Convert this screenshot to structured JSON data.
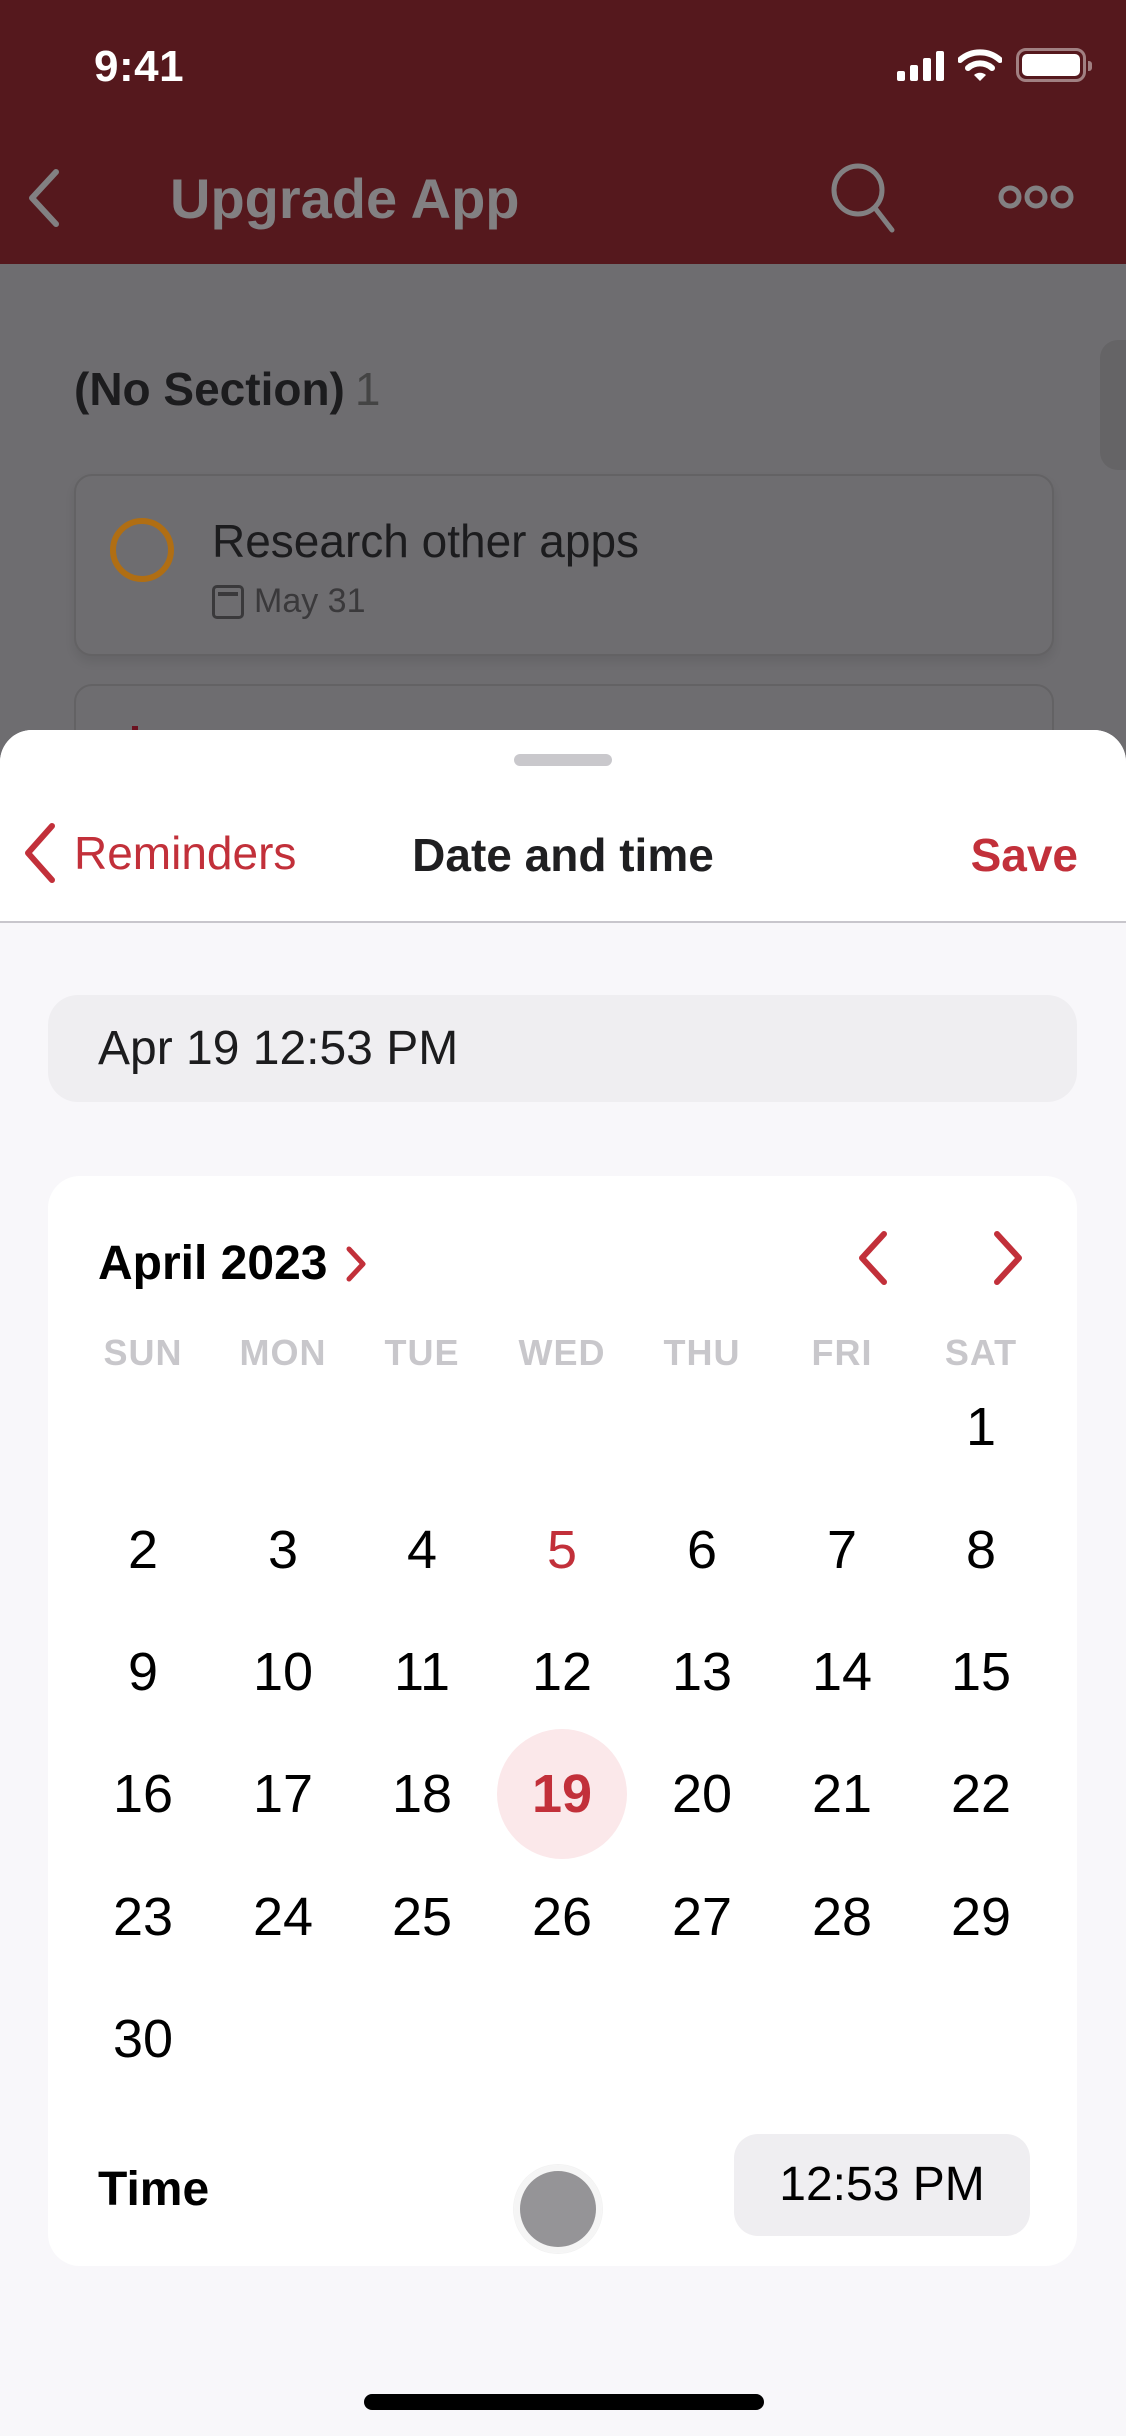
{
  "status_bar": {
    "time": "9:41"
  },
  "background_app": {
    "header": {
      "title": "Upgrade App",
      "back_icon": "chevron-left-icon",
      "search_icon": "search-icon",
      "more_icon": "more-horizontal-icon"
    },
    "section": {
      "title": "(No Section)",
      "count": "1"
    },
    "task": {
      "name": "Research other apps",
      "due": "May 31",
      "due_icon": "calendar-icon"
    }
  },
  "sheet": {
    "back_label": "Reminders",
    "title": "Date and time",
    "save_label": "Save",
    "date_field_value": "Apr 19 12:53 PM",
    "calendar": {
      "month_label": "April 2023",
      "weekdays": [
        "SUN",
        "MON",
        "TUE",
        "WED",
        "THU",
        "FRI",
        "SAT"
      ],
      "first_weekday_index": 6,
      "days_in_month": 30,
      "today": 5,
      "selected": 19
    },
    "time_label": "Time",
    "time_value": "12:53 PM"
  },
  "colors": {
    "accent": "#c2303a",
    "header_bg": "#55181d",
    "selected_bg": "#fbe8ea"
  }
}
